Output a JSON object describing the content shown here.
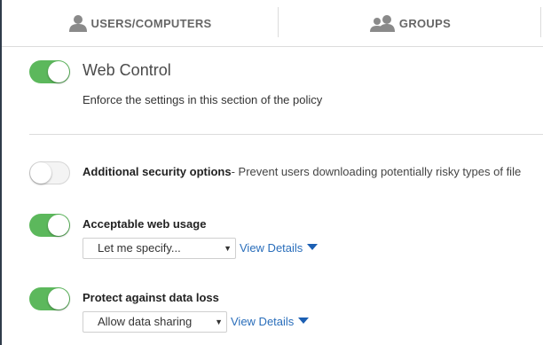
{
  "tabs": [
    {
      "label": "USERS/COMPUTERS",
      "icon": "user-icon"
    },
    {
      "label": "GROUPS",
      "icon": "group-icon"
    }
  ],
  "section": {
    "title": "Web Control",
    "description": "Enforce the settings in this section of the policy",
    "enabled": true
  },
  "options": [
    {
      "title": "Additional security options",
      "description": "- Prevent users downloading potentially risky types of file",
      "enabled": false
    },
    {
      "title": "Acceptable web usage",
      "enabled": true,
      "select_value": "Let me specify...",
      "view_details": "View Details"
    },
    {
      "title": "Protect against data loss",
      "enabled": true,
      "select_value": "Allow data sharing",
      "view_details": "View Details"
    }
  ],
  "colors": {
    "toggle_on": "#5cb85c",
    "link": "#2a6ebb",
    "rail": "#2f3b4a"
  }
}
